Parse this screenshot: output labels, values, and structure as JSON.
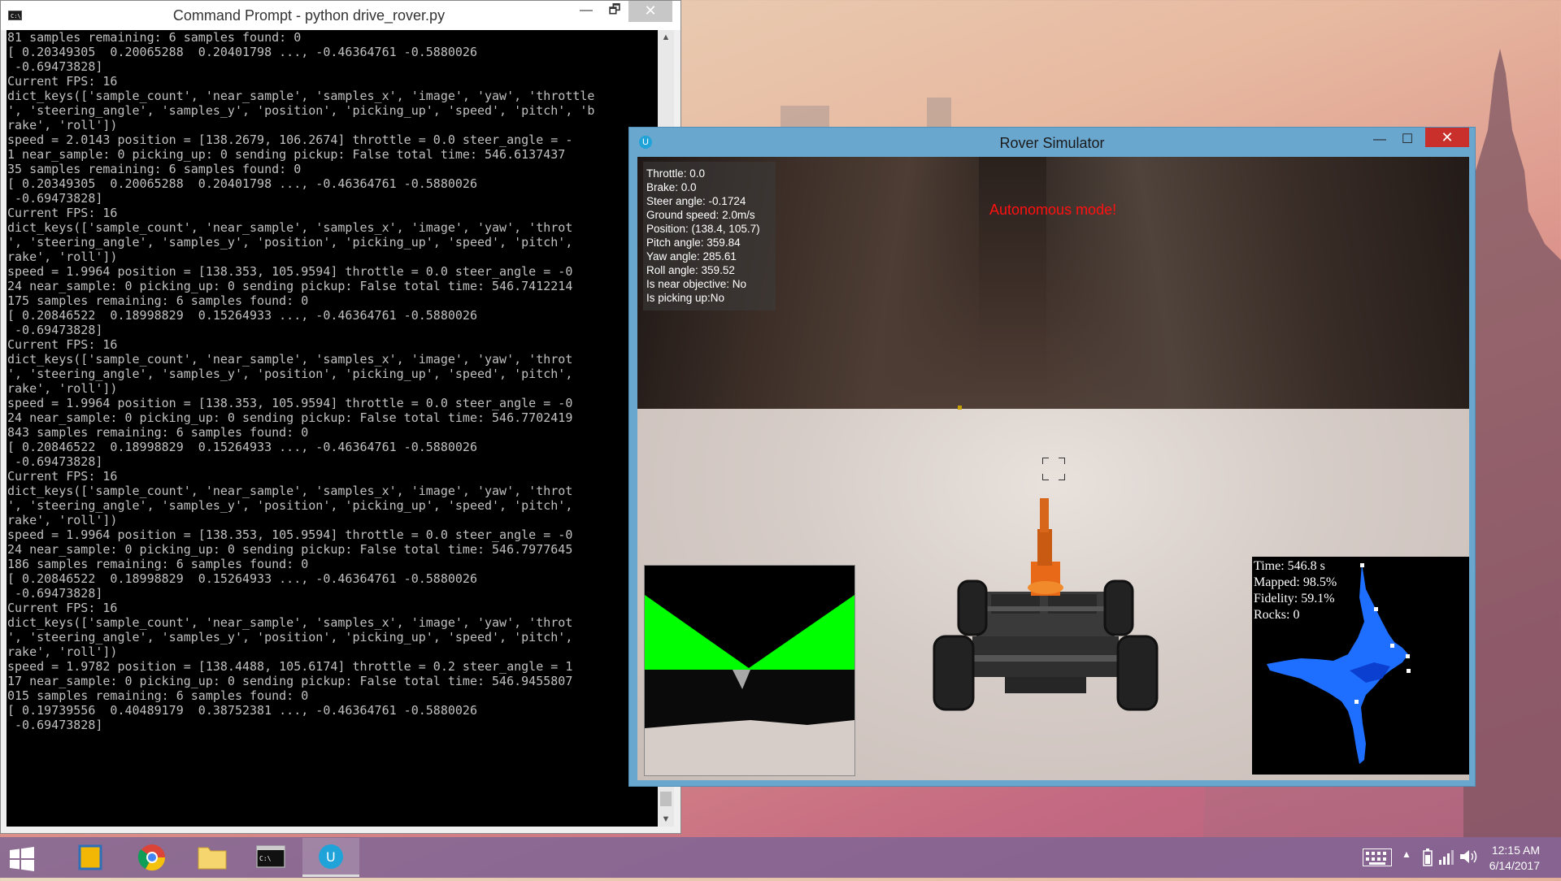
{
  "desktop": {
    "wallpaper": "city-skyline-sunset"
  },
  "cmd_window": {
    "title": "Command Prompt - python  drive_rover.py",
    "controls": {
      "minimize": "—",
      "maximize": "🗗",
      "close": "✕"
    },
    "lines": [
      "81 samples remaining: 6 samples found: 0",
      "[ 0.20349305  0.20065288  0.20401798 ..., -0.46364761 -0.5880026",
      " -0.69473828]",
      "Current FPS: 16",
      "dict_keys(['sample_count', 'near_sample', 'samples_x', 'image', 'yaw', 'throttle",
      "', 'steering_angle', 'samples_y', 'position', 'picking_up', 'speed', 'pitch', 'b",
      "rake', 'roll'])",
      "speed = 2.0143 position = [138.2679, 106.2674] throttle = 0.0 steer_angle = -",
      "1 near_sample: 0 picking_up: 0 sending pickup: False total time: 546.6137437",
      "35 samples remaining: 6 samples found: 0",
      "[ 0.20349305  0.20065288  0.20401798 ..., -0.46364761 -0.5880026",
      " -0.69473828]",
      "Current FPS: 16",
      "dict_keys(['sample_count', 'near_sample', 'samples_x', 'image', 'yaw', 'throt",
      "', 'steering_angle', 'samples_y', 'position', 'picking_up', 'speed', 'pitch',",
      "rake', 'roll'])",
      "speed = 1.9964 position = [138.353, 105.9594] throttle = 0.0 steer_angle = -0",
      "24 near_sample: 0 picking_up: 0 sending pickup: False total time: 546.7412214",
      "175 samples remaining: 6 samples found: 0",
      "[ 0.20846522  0.18998829  0.15264933 ..., -0.46364761 -0.5880026",
      " -0.69473828]",
      "Current FPS: 16",
      "dict_keys(['sample_count', 'near_sample', 'samples_x', 'image', 'yaw', 'throt",
      "', 'steering_angle', 'samples_y', 'position', 'picking_up', 'speed', 'pitch',",
      "rake', 'roll'])",
      "speed = 1.9964 position = [138.353, 105.9594] throttle = 0.0 steer_angle = -0",
      "24 near_sample: 0 picking_up: 0 sending pickup: False total time: 546.7702419",
      "843 samples remaining: 6 samples found: 0",
      "[ 0.20846522  0.18998829  0.15264933 ..., -0.46364761 -0.5880026",
      " -0.69473828]",
      "Current FPS: 16",
      "dict_keys(['sample_count', 'near_sample', 'samples_x', 'image', 'yaw', 'throt",
      "', 'steering_angle', 'samples_y', 'position', 'picking_up', 'speed', 'pitch',",
      "rake', 'roll'])",
      "speed = 1.9964 position = [138.353, 105.9594] throttle = 0.0 steer_angle = -0",
      "24 near_sample: 0 picking_up: 0 sending pickup: False total time: 546.7977645",
      "186 samples remaining: 6 samples found: 0",
      "[ 0.20846522  0.18998829  0.15264933 ..., -0.46364761 -0.5880026",
      " -0.69473828]",
      "Current FPS: 16",
      "dict_keys(['sample_count', 'near_sample', 'samples_x', 'image', 'yaw', 'throt",
      "', 'steering_angle', 'samples_y', 'position', 'picking_up', 'speed', 'pitch',",
      "rake', 'roll'])",
      "speed = 1.9782 position = [138.4488, 105.6174] throttle = 0.2 steer_angle = 1",
      "17 near_sample: 0 picking_up: 0 sending pickup: False total time: 546.9455807",
      "015 samples remaining: 6 samples found: 0",
      "[ 0.19739556  0.40489179  0.38752381 ..., -0.46364761 -0.5880026",
      " -0.69473828]"
    ]
  },
  "rover_window": {
    "title": "Rover Simulator",
    "controls": {
      "minimize": "—",
      "maximize": "☐",
      "close": "✕"
    },
    "telemetry": [
      "Throttle: 0.0",
      "Brake: 0.0",
      "Steer angle: -0.1724",
      "Ground speed: 2.0m/s",
      "Position: (138.4, 105.7)",
      "Pitch angle: 359.84",
      "Yaw angle: 285.61",
      "Roll angle: 359.52",
      "Is near objective: No",
      "Is picking up:No"
    ],
    "mode": "Autonomous mode!",
    "map_stats": {
      "time": "Time: 546.8 s",
      "mapped": "Mapped: 98.5%",
      "fidelity": "Fidelity: 59.1%",
      "rocks": "Rocks: 0"
    }
  },
  "taskbar": {
    "items": [
      "start",
      "file-explorer-app",
      "chrome",
      "folder",
      "command-prompt",
      "unity-rover-simulator"
    ],
    "active_item": "unity-rover-simulator",
    "clock": {
      "time": "12:15 AM",
      "date": "6/14/2017"
    }
  },
  "colors": {
    "mode_text": "#ff1111",
    "nav_green": "#00ff00",
    "map_blue": "#1e6fff",
    "close_red": "#c9302c"
  }
}
